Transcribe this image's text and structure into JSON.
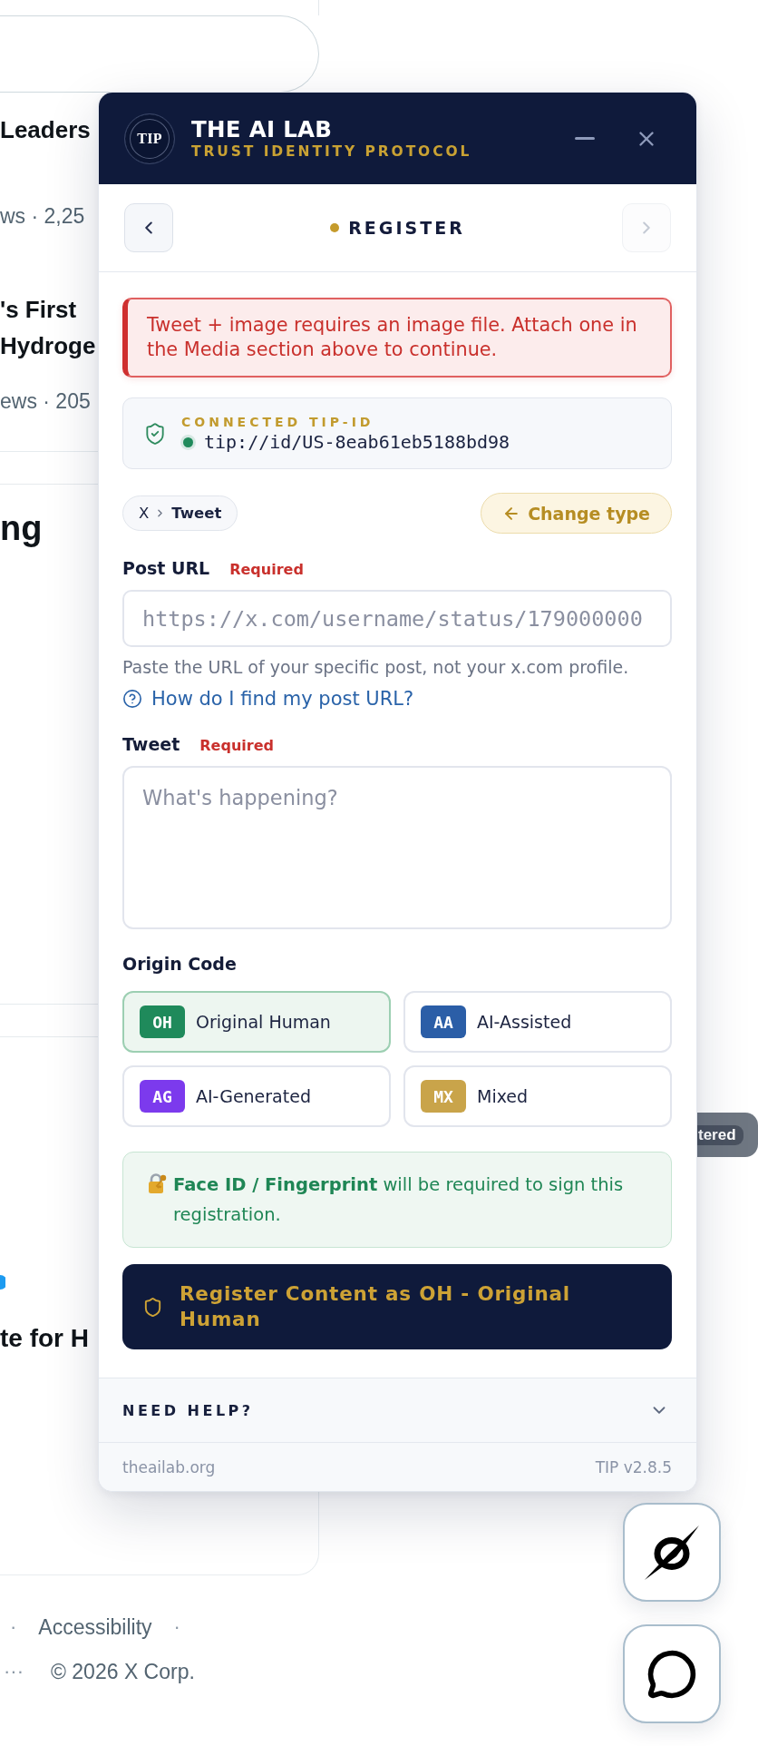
{
  "background_page": {
    "trends": [
      {
        "title_lines": [
          "Leaders"
        ],
        "meta": "ws · 2,25"
      },
      {
        "title_lines": [
          "'s First",
          "Hydroge"
        ],
        "meta": "ews · 205"
      }
    ],
    "section_heading": "ng",
    "trend_bottom": {
      "title": "te for H"
    },
    "footer": {
      "line_1": [
        "·",
        "Accessibility",
        "·"
      ],
      "line_2": [
        "···",
        "© 2026 X Corp."
      ]
    },
    "status_tag": "tered"
  },
  "extension_panel": {
    "header": {
      "logo_text": "TIP",
      "title": "THE AI LAB",
      "subtitle": "TRUST IDENTITY PROTOCOL"
    },
    "step_nav": {
      "back": {
        "disabled": false
      },
      "forward": {
        "disabled": true
      },
      "step": "REGISTER"
    },
    "error": "Tweet + image requires an image file. Attach one in the Media section above to continue.",
    "connected_id": {
      "label": "CONNECTED TIP-ID",
      "online": true,
      "value": "tip://id/US-8eab61eb5188bd98"
    },
    "type_row": {
      "breadcrumb": [
        "X",
        "Tweet"
      ],
      "change_button": "Change type"
    },
    "fields": [
      {
        "kind": "url",
        "label": "Post URL",
        "required_tag": "Required",
        "placeholder": "https://x.com/username/status/179000000",
        "hint": "Paste the URL of your specific post, not your x.com profile.",
        "help_link": "How do I find my post URL?"
      },
      {
        "kind": "textarea",
        "label": "Tweet",
        "required_tag": "Required",
        "placeholder": "What's happening?"
      }
    ],
    "origin_code": {
      "label": "Origin Code",
      "options": [
        {
          "code": "OH",
          "name": "Original Human",
          "color": "#1f8a5b",
          "selected": true
        },
        {
          "code": "AA",
          "name": "AI-Assisted",
          "color": "#2b5ea7",
          "selected": false
        },
        {
          "code": "AG",
          "name": "AI-Generated",
          "color": "#7c3aed",
          "selected": false
        },
        {
          "code": "MX",
          "name": "Mixed",
          "color": "#c9a44a",
          "selected": false
        }
      ]
    },
    "biometric_notice": "**Face ID / Fingerprint** will be required to sign this registration.",
    "submit_button": "Register Content as OH - Original Human",
    "help": {
      "title": "NEED HELP?",
      "expanded": false
    },
    "footer": {
      "site": "theailab.org",
      "version": "TIP v2.8.5"
    }
  },
  "floating_buttons": [
    {
      "kind": "logo"
    },
    {
      "kind": "chat"
    }
  ]
}
